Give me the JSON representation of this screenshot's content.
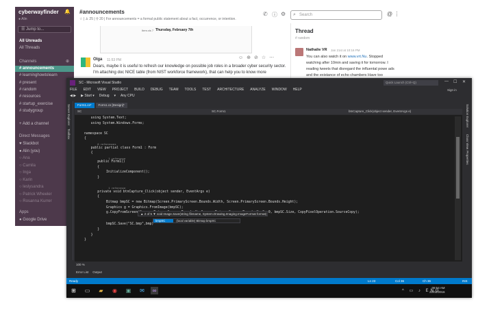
{
  "slack": {
    "workspace": "cyberwayfinder",
    "user": "Alin",
    "jump_placeholder": "Jump to...",
    "all_unreads": "All Unreads",
    "all_threads": "All Threads",
    "channels_header": "Channels",
    "channels": [
      "# announcements",
      "# learninghowtolearn",
      "# present",
      "# random",
      "# resources",
      "# startup_exercise",
      "# studygroup"
    ],
    "add_channel": "+ Add a channel",
    "dm_header": "Direct Messages",
    "dms": [
      "♥ Slackbot",
      "● Alin (you)",
      "○ Ana",
      "○ Camila",
      "○ Inga",
      "○ Karin",
      "○ leslysandra",
      "○ Patrick Wheeler",
      "○ Rosanna Kurrer"
    ],
    "apps_header": "Apps",
    "apps": [
      "● Google Drive"
    ],
    "channel_title": "#announcements",
    "channel_sub": "☆ | ♙ 25 | ⚲ 20 | For announcements = a formal public statement about a fact, occurrence, or intention.",
    "embed_date": "Thursday, February 7th",
    "embed_small": "Item.xls 7",
    "message": {
      "name": "Olga",
      "time": "11:53 PM",
      "body": "Dears, maybe it is useful to refresh our knowledge on possible job roles in a broader cyber security sector. I'm attaching doc NICE table (from NIST workforce framework), that can help you to know more"
    },
    "search_placeholder": "Search",
    "thread": {
      "title": "Thread",
      "sub": "# random",
      "name": "Nathalie VR",
      "time": "Jan 21st at 10:16 PM",
      "body_pre": "You can also watch it on ",
      "link": "www.vrt.Nu",
      "body_post": ". Stopped watching after 10min and saving it for tomorrow. I reading tweets that disregard the influental powe ads and the existance of echo chambers Have too"
    }
  },
  "vs": {
    "title": "SC - Microsoft Visual Studio",
    "quick_launch": "Quick Launch (Ctrl+Q)",
    "sign_in": "Sign in",
    "menu": [
      "FILE",
      "EDIT",
      "VIEW",
      "PROJECT",
      "BUILD",
      "DEBUG",
      "TEAM",
      "TOOLS",
      "TEST",
      "ARCHITECTURE",
      "ANALYZE",
      "WINDOW",
      "HELP"
    ],
    "toolbar": [
      "◀ ▶",
      "▶ Start ▾",
      "Debug",
      "▾",
      "Any CPU"
    ],
    "left_panels": [
      "Server Explorer",
      "Toolbox"
    ],
    "right_panels": [
      "Solution Explorer",
      "Class View",
      "Properties"
    ],
    "tabs": [
      "Form1.cs*",
      "Form1.cs [Design]*"
    ],
    "nav": {
      "project": "SC",
      "class": "SC.Form1",
      "member": "btnCapture_Click(object sender, EventArgs e)"
    },
    "code": [
      {
        "t": "using System.Text;",
        "k": "plain"
      },
      {
        "t": "using System.Windows.Forms;",
        "k": "plain"
      },
      {
        "t": "",
        "k": "plain"
      },
      {
        "t": "namespace SC",
        "k": "plain"
      },
      {
        "t": "{",
        "k": "plain"
      },
      {
        "t": "0 references",
        "k": "ref"
      },
      {
        "t": "public partial class Form1 : Form",
        "k": "plain"
      },
      {
        "t": "{",
        "k": "plain"
      },
      {
        "t": "1 reference",
        "k": "ref"
      },
      {
        "t": "public Form1()",
        "k": "plain"
      },
      {
        "t": "{",
        "k": "plain"
      },
      {
        "t": "InitializeComponent();",
        "k": "plain"
      },
      {
        "t": "}",
        "k": "plain"
      },
      {
        "t": "",
        "k": "plain"
      },
      {
        "t": "1 reference",
        "k": "ref"
      },
      {
        "t": "private void btnCapture_Click(object sender, EventArgs e)",
        "k": "plain"
      },
      {
        "t": "{",
        "k": "plain"
      },
      {
        "t": "Bitmap bmpSC = new Bitmap(Screen.PrimaryScreen.Bounds.Width, Screen.PrimaryScreen.Bounds.Height);",
        "k": "plain"
      },
      {
        "t": "Graphics g = Graphics.FromImage(bmpSC);",
        "k": "plain"
      },
      {
        "t": "g.CopyFromScreen(Screen.PrimaryScreen.Bounds.X, Screen.PrimaryScreen.Bounds.Y, 0, 0, bmpSC.Size, CopyPixelOperation.SourceCopy);",
        "k": "plain"
      },
      {
        "t": "",
        "k": "plain"
      },
      {
        "t": "bmpSC.Save(\"SC.bmp\",bmp)",
        "k": "plain"
      },
      {
        "t": "}",
        "k": "plain"
      },
      {
        "t": "}",
        "k": "plain"
      },
      {
        "t": "}",
        "k": "plain"
      }
    ],
    "signature": "▲ 2 of 5 ▼  void Image.Save(string filename, System.Drawing.Imaging.ImageFormat format)",
    "autocomplete_item": "bmpSC",
    "autocomplete_desc": "(local variable) Bitmap bmpSC",
    "zoom": "100 %",
    "bottom_tabs": [
      "Error List",
      "Output"
    ],
    "status": {
      "ready": "Ready",
      "ln": "Ln 23",
      "col": "Col 36",
      "ch": "Ch 36",
      "ins": "INS"
    },
    "tray": {
      "lang": "ENG",
      "time": "09:54 AM",
      "date": "22/02/2016"
    }
  }
}
